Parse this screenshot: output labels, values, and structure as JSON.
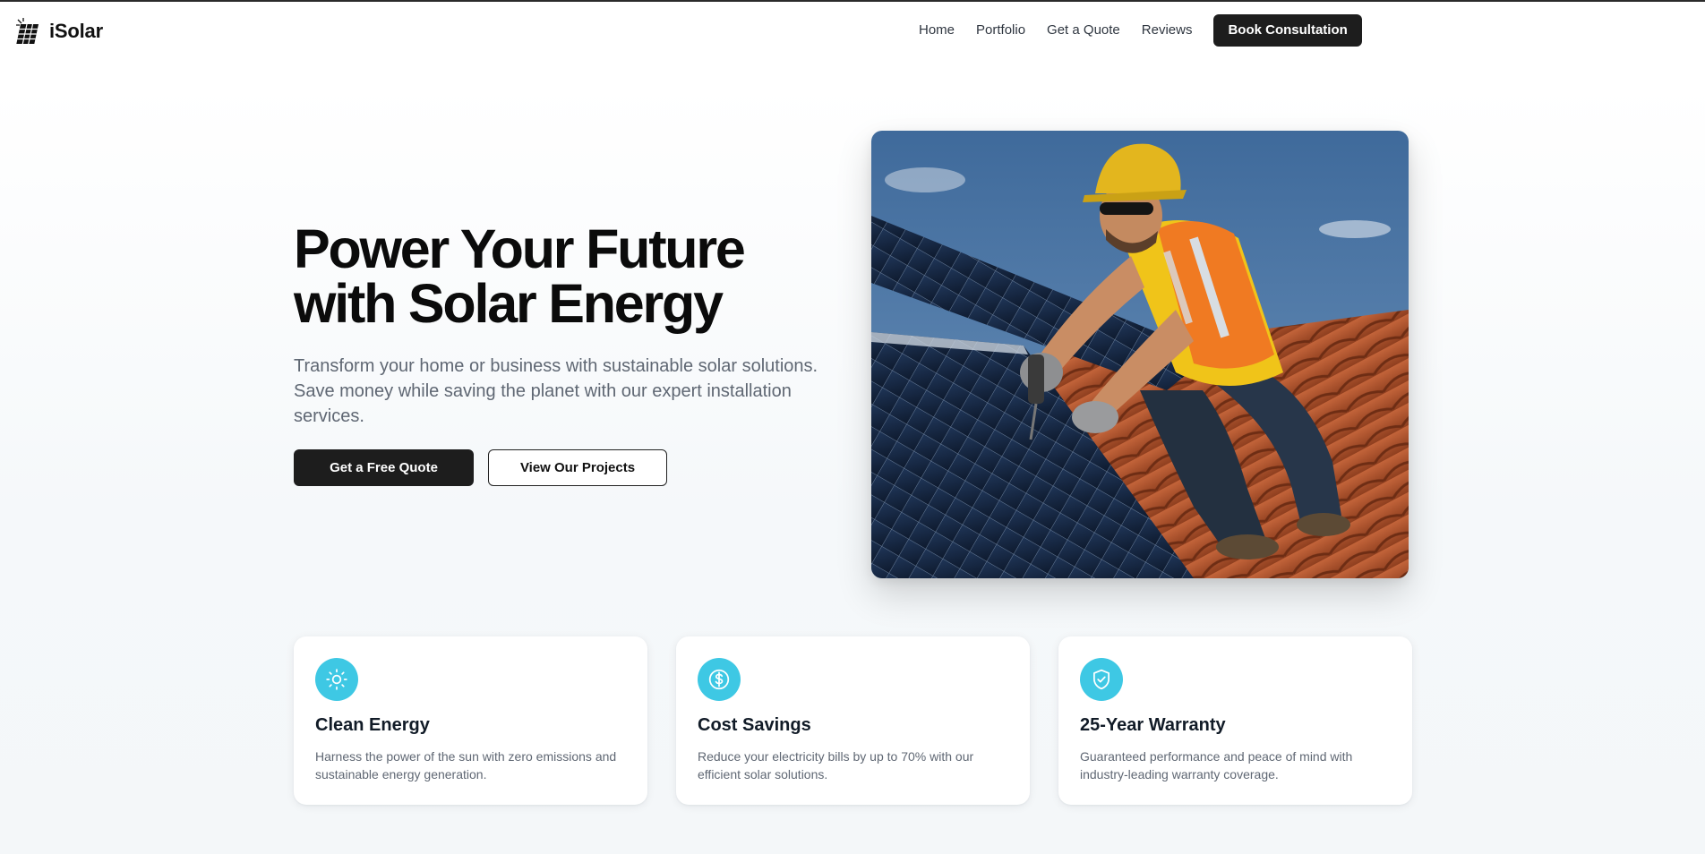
{
  "brand": {
    "name": "iSolar",
    "logo_icon": "solar-panel-icon"
  },
  "nav": {
    "links": [
      "Home",
      "Portfolio",
      "Get a Quote",
      "Reviews"
    ],
    "cta": "Book Consultation"
  },
  "hero": {
    "title_line1": "Power Your Future",
    "title_line2": "with Solar Energy",
    "subtitle": "Transform your home or business with sustainable solar solutions. Save money while saving the planet with our expert installation services.",
    "primary_cta": "Get a Free Quote",
    "secondary_cta": "View Our Projects",
    "image": "photo of a worker in a hard hat installing solar panels on a tiled roof"
  },
  "features": [
    {
      "icon": "sun-icon",
      "title": "Clean Energy",
      "text": "Harness the power of the sun with zero emissions and sustainable energy generation."
    },
    {
      "icon": "dollar-icon",
      "title": "Cost Savings",
      "text": "Reduce your electricity bills by up to 70% with our efficient solar solutions."
    },
    {
      "icon": "shield-check-icon",
      "title": "25-Year Warranty",
      "text": "Guaranteed performance and peace of mind with industry-leading warranty coverage."
    }
  ],
  "colors": {
    "accent": "#3ec8e4",
    "dark_button": "#1d1d1d",
    "body_text": "#5f6773"
  }
}
